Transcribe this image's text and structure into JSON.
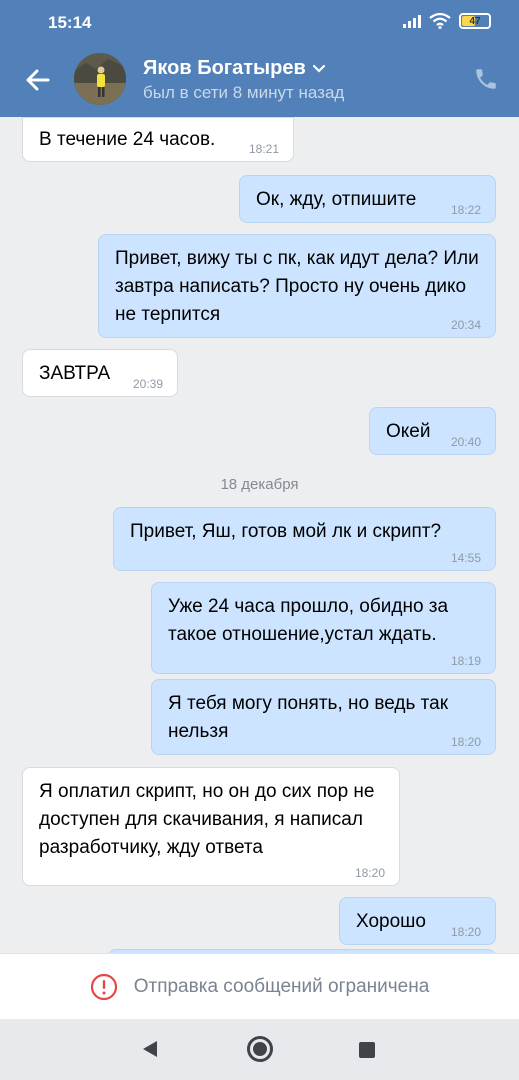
{
  "status_bar": {
    "time": "15:14",
    "battery": "47"
  },
  "header": {
    "contact_name": "Яков Богатырев",
    "contact_status": "был в сети 8 минут назад"
  },
  "messages": [
    {
      "dir": "in",
      "text": "В течение 24 часов.",
      "time": "18:21"
    },
    {
      "dir": "out",
      "text": "Ок, жду, отпишите",
      "time": "18:22"
    },
    {
      "dir": "out",
      "text": "Привет, вижу ты с пк, как идут дела? Или завтра написать? Просто ну очень дико не терпится",
      "time": "20:34"
    },
    {
      "dir": "in",
      "text": "ЗАВТРА",
      "time": "20:39"
    },
    {
      "dir": "out",
      "text": "Окей",
      "time": "20:40"
    },
    {
      "dir": "out",
      "text": "Привет, Яш, готов мой лк и скрипт?",
      "time": "14:55"
    },
    {
      "dir": "out",
      "text": "Уже 24 часа прошло, обидно за такое отношение,устал ждать.",
      "time": "18:19"
    },
    {
      "dir": "out",
      "text": "Я тебя могу понять, но ведь так нельзя",
      "time": "18:20"
    },
    {
      "dir": "in",
      "text": "Я оплатил скрипт, но он до сих пор не доступен для скачивания, я написал разработчику, жду ответа",
      "time": "18:20"
    },
    {
      "dir": "out",
      "text": "Хорошо",
      "time": "18:20"
    }
  ],
  "date_separator": "18 декабря",
  "restricted_bar": {
    "text": "Отправка сообщений ограничена"
  },
  "icons": {
    "back": "arrow-left-icon",
    "call": "phone-icon",
    "dropdown": "chevron-down-icon",
    "restricted": "alert-circle-icon"
  },
  "colors": {
    "header_bg": "#5181b8",
    "incoming_bubble": "#ffffff",
    "outgoing_bubble": "#cce4ff",
    "alert": "#e64646"
  }
}
